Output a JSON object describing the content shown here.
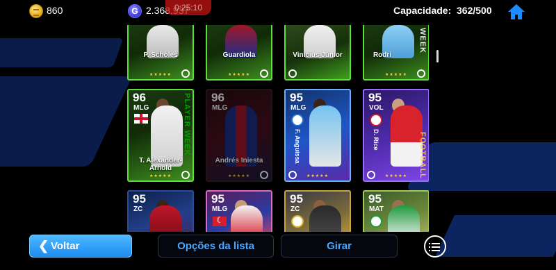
{
  "currency": {
    "coins": "860",
    "gp": "2.368.937",
    "gp_symbol": "G",
    "timer": "0:25:10"
  },
  "capacity": {
    "label": "Capacidade:",
    "value": "362/500"
  },
  "icons": {
    "home": "home-icon",
    "back": "chevron-left-icon",
    "menu": "list-menu-icon"
  },
  "cards": [
    {
      "name": "P. Scholes",
      "rating": "",
      "position": "",
      "stars": "★★★★★"
    },
    {
      "name": "Guardiola",
      "rating": "",
      "position": "",
      "stars": "★★★★★"
    },
    {
      "name": "Vinicius Júnior",
      "rating": "",
      "position": "",
      "stars": ""
    },
    {
      "name": "Rodri",
      "rating": "",
      "position": "",
      "stars": "★★★★★",
      "vertical": "WEEK"
    },
    {
      "name": "T. Alexander-Arnold",
      "rating": "96",
      "position": "MLG",
      "stars": "★★★★★",
      "vertical": "PLAYER WEEK"
    },
    {
      "name": "Andrés Iniesta",
      "rating": "96",
      "position": "MLG",
      "stars": "★★★★★"
    },
    {
      "name": "F. Anguissa",
      "rating": "95",
      "position": "MLG",
      "stars": "★★★★★"
    },
    {
      "name": "D. Rice",
      "rating": "95",
      "position": "VOL",
      "stars": "★★★★★",
      "vertical": "FOOTBALL"
    },
    {
      "name": "",
      "rating": "95",
      "position": "ZC"
    },
    {
      "name": "",
      "rating": "95",
      "position": "MLG"
    },
    {
      "name": "",
      "rating": "95",
      "position": "ZC"
    },
    {
      "name": "",
      "rating": "95",
      "position": "MAT"
    }
  ],
  "buttons": {
    "back": "Voltar",
    "list_options": "Opções da lista",
    "rotate": "Girar"
  }
}
